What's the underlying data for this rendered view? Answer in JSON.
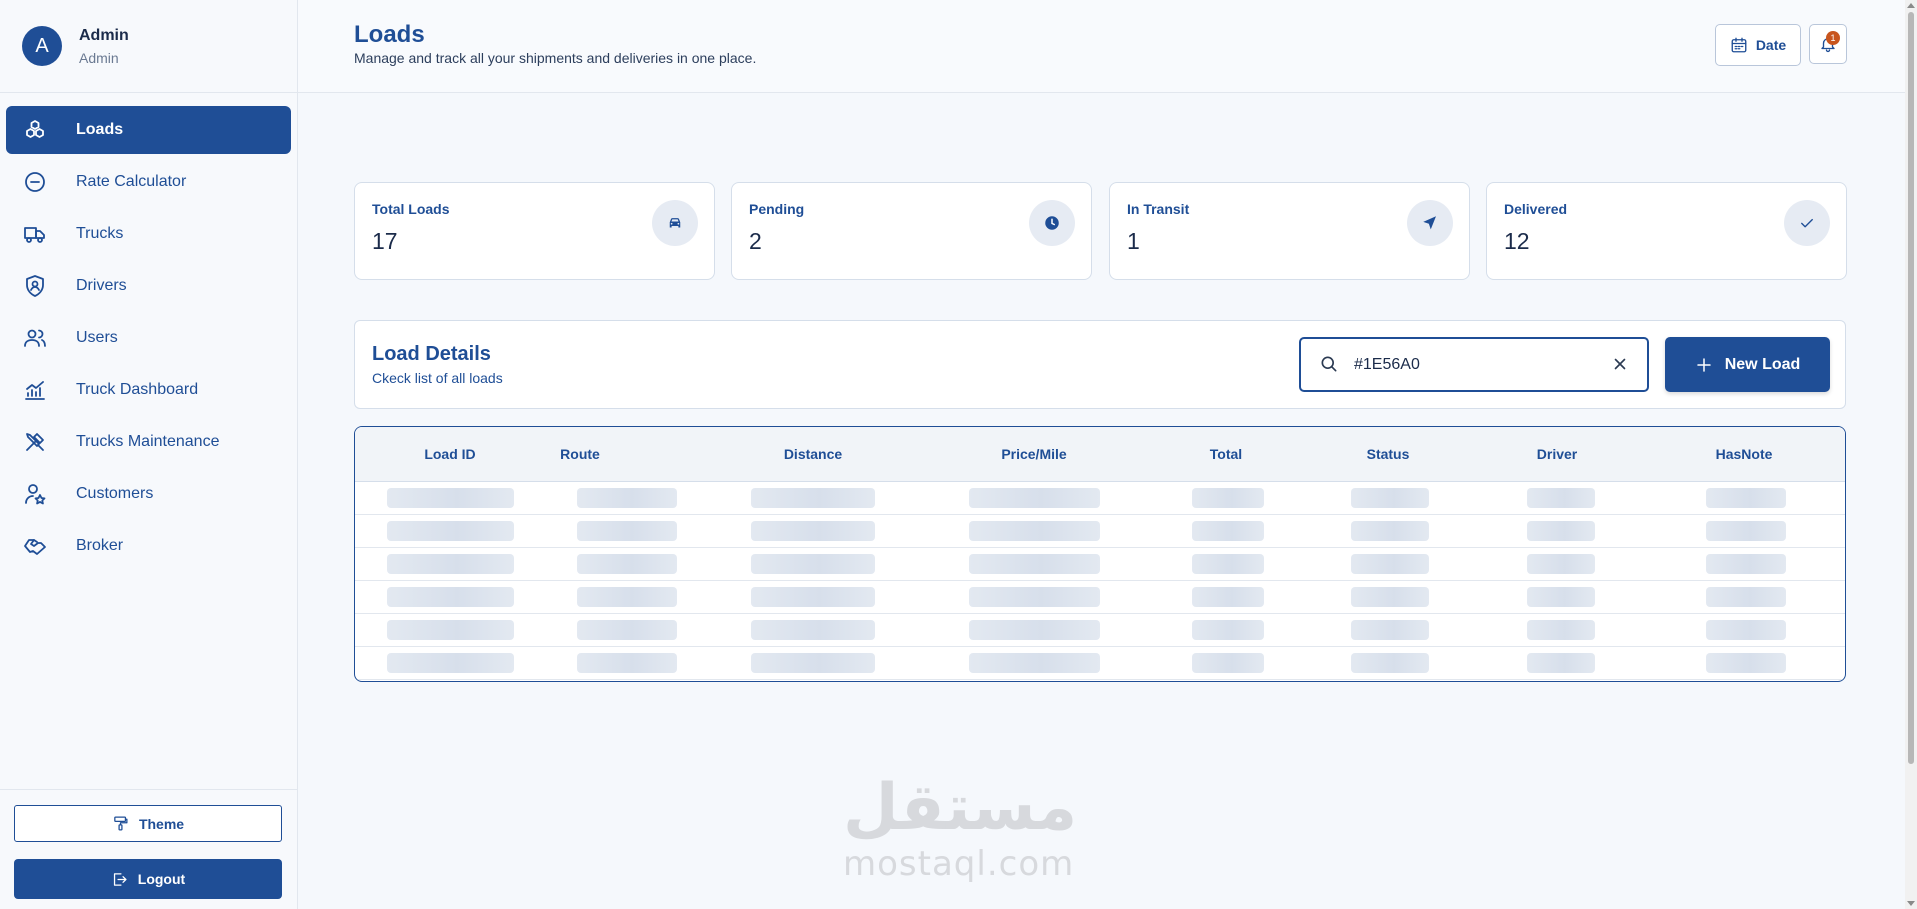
{
  "user": {
    "avatar_initial": "A",
    "name": "Admin",
    "role": "Admin"
  },
  "sidebar": {
    "items": [
      {
        "label": "Loads",
        "icon": "boxes-icon",
        "active": true
      },
      {
        "label": "Rate Calculator",
        "icon": "calculator-icon",
        "active": false
      },
      {
        "label": "Trucks",
        "icon": "truck-icon",
        "active": false
      },
      {
        "label": "Drivers",
        "icon": "shield-user-icon",
        "active": false
      },
      {
        "label": "Users",
        "icon": "users-icon",
        "active": false
      },
      {
        "label": "Truck Dashboard",
        "icon": "chart-icon",
        "active": false
      },
      {
        "label": "Trucks Maintenance",
        "icon": "tools-icon",
        "active": false
      },
      {
        "label": "Customers",
        "icon": "user-star-icon",
        "active": false
      },
      {
        "label": "Broker",
        "icon": "handshake-icon",
        "active": false
      }
    ],
    "theme_label": "Theme",
    "logout_label": "Logout"
  },
  "header": {
    "title": "Loads",
    "subtitle": "Manage and track all your shipments and deliveries in one place.",
    "date_label": "Date",
    "notification_count": "1"
  },
  "stats": [
    {
      "label": "Total Loads",
      "value": "17",
      "icon": "car-icon"
    },
    {
      "label": "Pending",
      "value": "2",
      "icon": "clock-icon"
    },
    {
      "label": "In Transit",
      "value": "1",
      "icon": "navigation-icon"
    },
    {
      "label": "Delivered",
      "value": "12",
      "icon": "check-icon"
    }
  ],
  "details": {
    "title": "Load Details",
    "subtitle": "Ckeck list of all loads",
    "search_value": "#1E56A0",
    "new_button": "New Load"
  },
  "table": {
    "columns": [
      "Load ID",
      "Route",
      "Distance",
      "Price/Mile",
      "Total",
      "Status",
      "Driver",
      "HasNote"
    ],
    "loading_rows": 6
  },
  "watermark": {
    "arabic": "مستقل",
    "latin": "mostaql.com"
  },
  "colors": {
    "primary": "#1F4E96",
    "background": "#F5F8FC",
    "badge": "#C8551E"
  }
}
